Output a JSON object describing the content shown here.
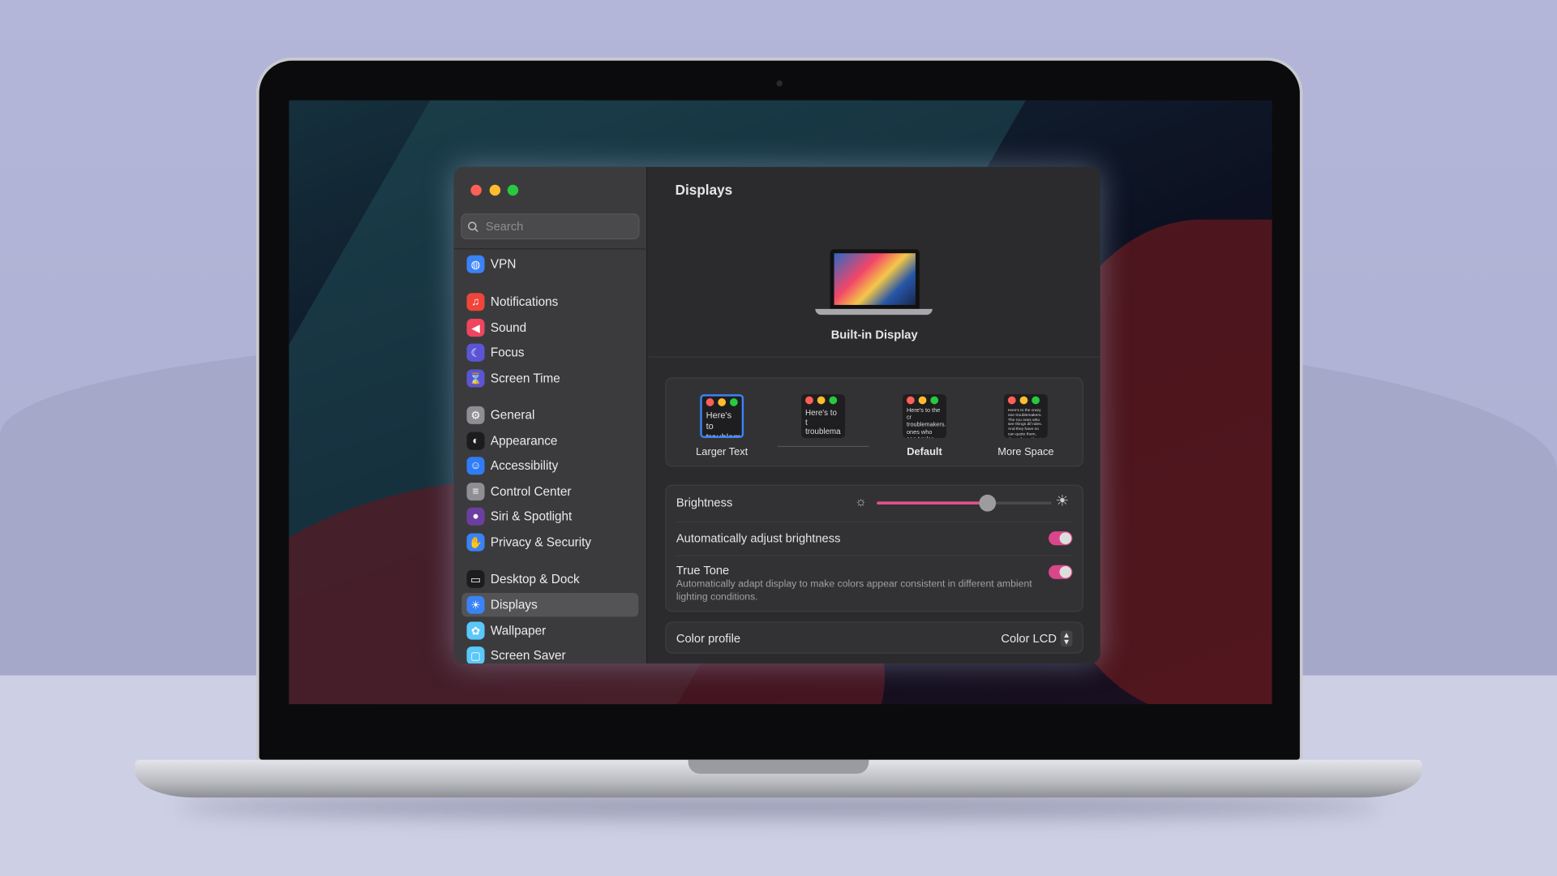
{
  "window": {
    "title": "Displays",
    "traffic_lights": {
      "close": "#ff5f57",
      "minimize": "#febc2e",
      "zoom": "#28c840"
    }
  },
  "sidebar": {
    "search_placeholder": "Search",
    "selected": "Displays",
    "items": [
      {
        "label": "VPN",
        "icon": "globe-icon",
        "color": "#3a82f7"
      },
      {
        "label": "Notifications",
        "icon": "bell-icon",
        "color": "#f0453a"
      },
      {
        "label": "Sound",
        "icon": "speaker-icon",
        "color": "#f0445f"
      },
      {
        "label": "Focus",
        "icon": "moon-icon",
        "color": "#5b55d6"
      },
      {
        "label": "Screen Time",
        "icon": "hourglass-icon",
        "color": "#5b55d6"
      },
      {
        "label": "General",
        "icon": "gear-icon",
        "color": "#8e8e93"
      },
      {
        "label": "Appearance",
        "icon": "appearance-icon",
        "color": "#1c1c1e"
      },
      {
        "label": "Accessibility",
        "icon": "accessibility-icon",
        "color": "#2f7cf6"
      },
      {
        "label": "Control Center",
        "icon": "toggles-icon",
        "color": "#8e8e93"
      },
      {
        "label": "Siri & Spotlight",
        "icon": "siri-icon",
        "color": "#6b3fa0"
      },
      {
        "label": "Privacy & Security",
        "icon": "hand-icon",
        "color": "#3a82f7"
      },
      {
        "label": "Desktop & Dock",
        "icon": "dock-icon",
        "color": "#1c1c1e"
      },
      {
        "label": "Displays",
        "icon": "sun-icon",
        "color": "#3a82f7"
      },
      {
        "label": "Wallpaper",
        "icon": "flower-icon",
        "color": "#5ac8fa"
      },
      {
        "label": "Screen Saver",
        "icon": "screensaver-icon",
        "color": "#5ac8fa"
      }
    ]
  },
  "main": {
    "display_name": "Built-in Display",
    "resolution_options": [
      {
        "label": "Larger Text",
        "preview": "Here's to troublem",
        "selected": true
      },
      {
        "label": "",
        "preview": "Here's to t troublema ones who",
        "selected": false
      },
      {
        "label": "Default",
        "preview": "Here's to the cr troublemakers. ones who see t rules. And they",
        "selected": false
      },
      {
        "label": "More Space",
        "preview": "Here's to the crazy one troublemakers. The rou ones who see things dif rules. And they have no can quote them, disagr them. About the only th Because they change it",
        "selected": false
      }
    ],
    "brightness": {
      "label": "Brightness",
      "value": 0.63,
      "accent": "#e0528c"
    },
    "auto_brightness": {
      "label": "Automatically adjust brightness",
      "on": true
    },
    "true_tone": {
      "label": "True Tone",
      "description": "Automatically adapt display to make colors appear consistent in different ambient lighting conditions.",
      "on": true
    },
    "color_profile": {
      "label": "Color profile",
      "value": "Color LCD"
    }
  }
}
